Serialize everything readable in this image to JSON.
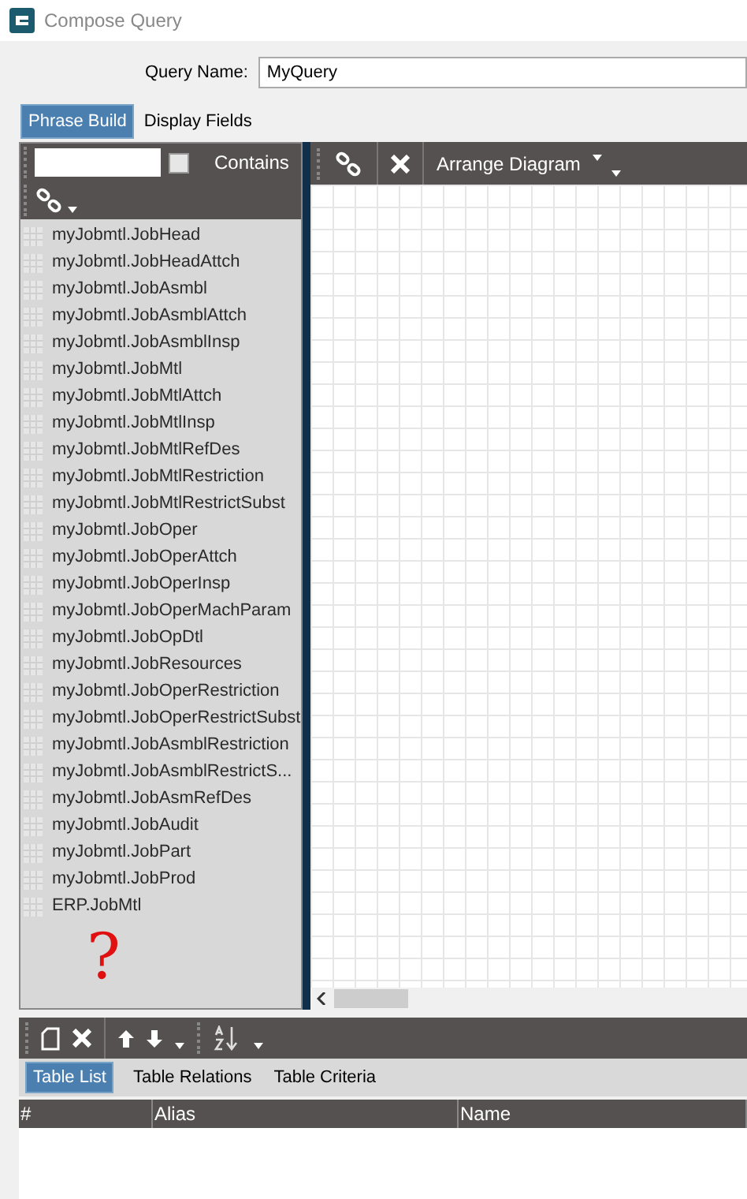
{
  "window": {
    "title": "Compose Query"
  },
  "query_name": {
    "label": "Query Name:",
    "value": "MyQuery"
  },
  "tabs": [
    {
      "label": "Phrase Build",
      "selected": true
    },
    {
      "label": "Display Fields",
      "selected": false
    }
  ],
  "table_panel": {
    "contains": {
      "label": "Contains",
      "checked": false
    },
    "tables": [
      {
        "name": "myJobmtl.JobHead"
      },
      {
        "name": "myJobmtl.JobHeadAttch"
      },
      {
        "name": "myJobmtl.JobAsmbl"
      },
      {
        "name": "myJobmtl.JobAsmblAttch"
      },
      {
        "name": "myJobmtl.JobAsmblInsp"
      },
      {
        "name": "myJobmtl.JobMtl"
      },
      {
        "name": "myJobmtl.JobMtlAttch"
      },
      {
        "name": "myJobmtl.JobMtlInsp"
      },
      {
        "name": "myJobmtl.JobMtlRefDes"
      },
      {
        "name": "myJobmtl.JobMtlRestriction"
      },
      {
        "name": "myJobmtl.JobMtlRestrictSubst"
      },
      {
        "name": "myJobmtl.JobOper"
      },
      {
        "name": "myJobmtl.JobOperAttch"
      },
      {
        "name": "myJobmtl.JobOperInsp"
      },
      {
        "name": "myJobmtl.JobOperMachParam"
      },
      {
        "name": "myJobmtl.JobOpDtl"
      },
      {
        "name": "myJobmtl.JobResources"
      },
      {
        "name": "myJobmtl.JobOperRestriction"
      },
      {
        "name": "myJobmtl.JobOperRestrictSubst"
      },
      {
        "name": "myJobmtl.JobAsmblRestriction"
      },
      {
        "name": "myJobmtl.JobAsmblRestrictS..."
      },
      {
        "name": "myJobmtl.JobAsmRefDes"
      },
      {
        "name": "myJobmtl.JobAudit"
      },
      {
        "name": "myJobmtl.JobPart"
      },
      {
        "name": "myJobmtl.JobProd"
      },
      {
        "name": "ERP.JobMtl"
      }
    ],
    "annotation": "?"
  },
  "diagram_toolbar": {
    "arrange": "Arrange Diagram"
  },
  "bottom_tabs": [
    {
      "label": "Table List",
      "selected": true
    },
    {
      "label": "Table Relations",
      "selected": false
    },
    {
      "label": "Table Criteria",
      "selected": false
    }
  ],
  "table_list": {
    "columns": [
      "#",
      "Alias",
      "Name"
    ]
  }
}
